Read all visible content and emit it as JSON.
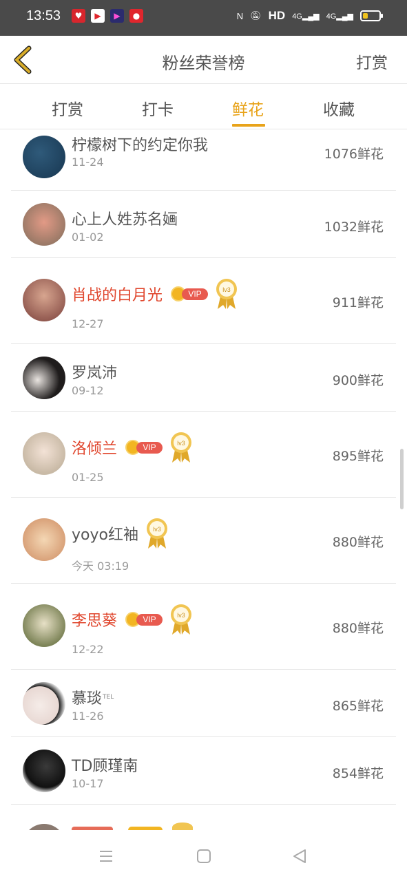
{
  "status_bar": {
    "time": "13:53",
    "network_label": "HD",
    "signal1": "4G",
    "signal2": "4G",
    "battery_level": 0.3
  },
  "header": {
    "title": "粉丝荣誉榜",
    "right_action": "打赏"
  },
  "tabs": [
    {
      "label": "打赏",
      "active": false
    },
    {
      "label": "打卡",
      "active": false
    },
    {
      "label": "鲜花",
      "active": true
    },
    {
      "label": "收藏",
      "active": false
    }
  ],
  "rows": [
    {
      "name": "柠檬树下的约定你我",
      "date": "11-24",
      "count": "1076鲜花",
      "vip": false,
      "medal": false,
      "tel": ""
    },
    {
      "name": "心上人姓苏名婳",
      "date": "01-02",
      "count": "1032鲜花",
      "vip": false,
      "medal": false,
      "tel": ""
    },
    {
      "name": "肖战的白月光",
      "date": "12-27",
      "count": "911鲜花",
      "vip": true,
      "medal": true,
      "tel": ""
    },
    {
      "name": "罗岚沛",
      "date": "09-12",
      "count": "900鲜花",
      "vip": false,
      "medal": false,
      "tel": ""
    },
    {
      "name": "洛倾兰",
      "date": "01-25",
      "count": "895鲜花",
      "vip": true,
      "medal": true,
      "tel": ""
    },
    {
      "name": "yoyo红袖",
      "date": "今天 03:19",
      "count": "880鲜花",
      "vip": false,
      "medal": true,
      "tel": ""
    },
    {
      "name": "李思葵",
      "date": "12-22",
      "count": "880鲜花",
      "vip": true,
      "medal": true,
      "tel": ""
    },
    {
      "name": "慕琰",
      "date": "11-26",
      "count": "865鲜花",
      "vip": false,
      "medal": false,
      "tel": "TEL"
    },
    {
      "name": "TD顾瑾南",
      "date": "10-17",
      "count": "854鲜花",
      "vip": false,
      "medal": false,
      "tel": ""
    }
  ],
  "badges": {
    "vip_label": "VIP",
    "medal_label": "lv3"
  },
  "colors": {
    "accent": "#e8a31a",
    "vip_name": "#e0472e",
    "vip_pill": "#e85a4f",
    "statusbar": "#4a4a4a"
  }
}
